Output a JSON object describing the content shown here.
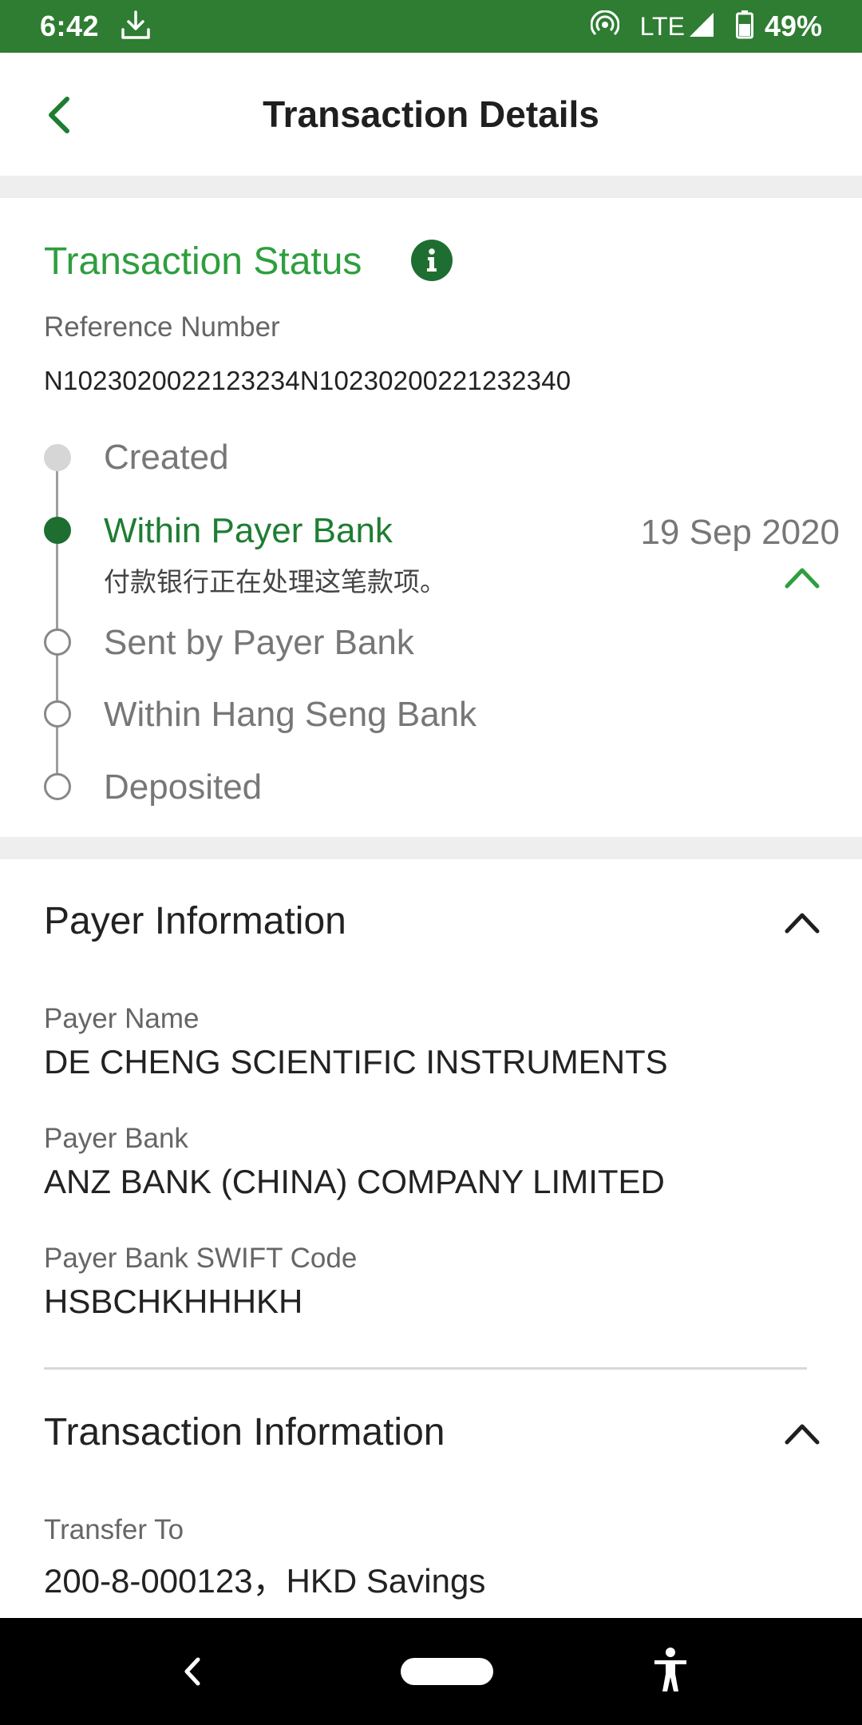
{
  "status_bar": {
    "time": "6:42",
    "network": "LTE",
    "battery": "49%"
  },
  "header": {
    "title": "Transaction Details"
  },
  "transaction_status": {
    "heading": "Transaction Status",
    "reference_label": "Reference Number",
    "reference_value": "N102302002212323­4N10230200221232340",
    "steps": [
      {
        "label": "Created",
        "state": "done"
      },
      {
        "label": "Within Payer Bank",
        "state": "current",
        "note": "付款银行正在处理这笔款项。",
        "date": "19 Sep 2020"
      },
      {
        "label": "Sent by Payer Bank",
        "state": "pending"
      },
      {
        "label": "Within Hang Seng Bank",
        "state": "pending"
      },
      {
        "label": "Deposited",
        "state": "pending"
      }
    ]
  },
  "payer_information": {
    "title": "Payer Information",
    "fields": [
      {
        "label": "Payer Name",
        "value": "DE CHENG SCIENTIFIC INSTRUMENTS"
      },
      {
        "label": "Payer Bank",
        "value": "ANZ BANK (CHINA) COMPANY LIMITED"
      },
      {
        "label": "Payer Bank SWIFT Code",
        "value": "HSBCHKHHHKH"
      }
    ]
  },
  "transaction_information": {
    "title": "Transaction Information",
    "fields": [
      {
        "label": "Transfer To",
        "value": "200-8-000123，HKD Savings"
      }
    ]
  },
  "colors": {
    "brand_green": "#2e7d32",
    "status_green": "#2e9e3e",
    "dark_green": "#1e6e32"
  }
}
